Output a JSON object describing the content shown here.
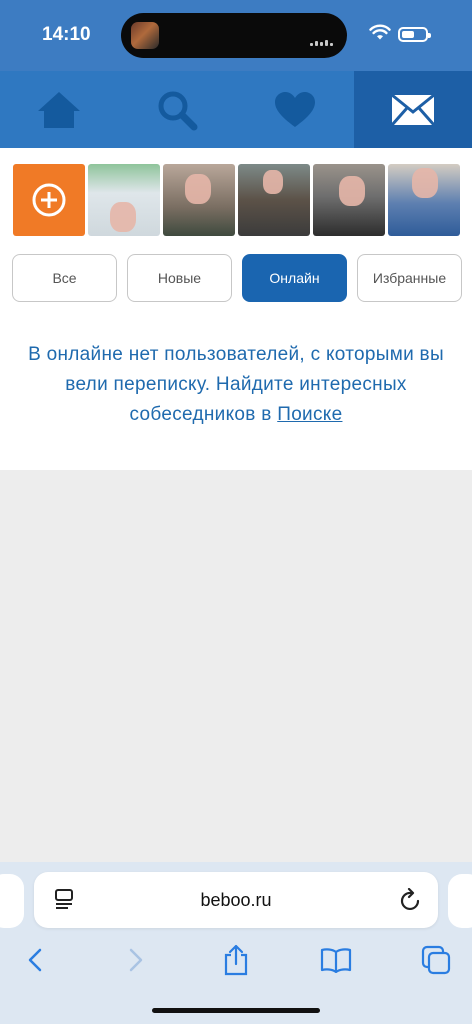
{
  "status_bar": {
    "time": "14:10"
  },
  "nav": {
    "items": [
      {
        "icon": "home-icon"
      },
      {
        "icon": "search-icon"
      },
      {
        "icon": "heart-icon"
      },
      {
        "icon": "mail-icon",
        "active": true
      }
    ]
  },
  "stories": {
    "add_icon": "plus-circle-icon",
    "count": 5
  },
  "filters": [
    {
      "label": "Все"
    },
    {
      "label": "Новые"
    },
    {
      "label": "Онлайн",
      "active": true
    },
    {
      "label": "Избранные"
    }
  ],
  "empty_state": {
    "message": "В онлайне нет пользователей, с которыми вы вели переписку. Найдите интересных собеседников в",
    "link_text": "Поиске"
  },
  "browser": {
    "url": "beboo.ru",
    "toolbar": [
      "back-icon",
      "forward-icon",
      "share-icon",
      "bookmarks-icon",
      "tabs-icon"
    ]
  },
  "colors": {
    "nav_bg": "#2f78c1",
    "nav_active": "#1d5fa6",
    "accent_orange": "#f07a26",
    "filter_active": "#1a65b0",
    "message_text": "#1f6aae"
  }
}
